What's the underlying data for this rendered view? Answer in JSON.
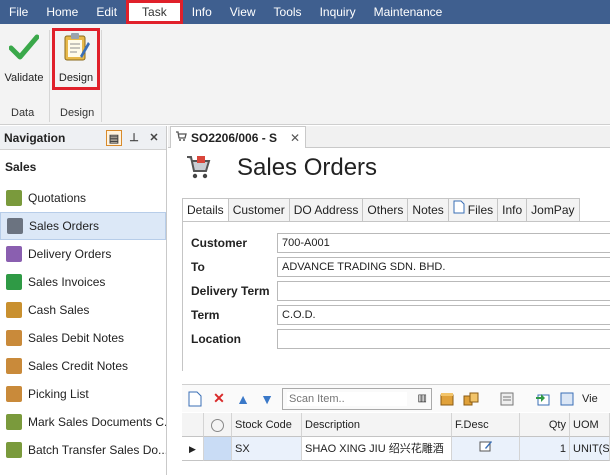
{
  "menu": [
    "File",
    "Home",
    "Edit",
    "Task",
    "Info",
    "View",
    "Tools",
    "Inquiry",
    "Maintenance"
  ],
  "menu_active": "Task",
  "ribbon": {
    "validate_label": "Validate",
    "design_label": "Design",
    "group_data": "Data",
    "group_design": "Design"
  },
  "nav": {
    "title": "Navigation",
    "section": "Sales",
    "items": [
      {
        "label": "Quotations",
        "icon": "quotation-icon",
        "color": "#7a9a3c"
      },
      {
        "label": "Sales Orders",
        "icon": "cart-icon",
        "color": "#6b7380"
      },
      {
        "label": "Delivery Orders",
        "icon": "delivery-icon",
        "color": "#8a5fb0"
      },
      {
        "label": "Sales Invoices",
        "icon": "dollar-icon",
        "color": "#2f9a45"
      },
      {
        "label": "Cash Sales",
        "icon": "cash-icon",
        "color": "#c9902f"
      },
      {
        "label": "Sales Debit Notes",
        "icon": "debit-note-icon",
        "color": "#c98a3a"
      },
      {
        "label": "Sales Credit Notes",
        "icon": "credit-note-icon",
        "color": "#c98a3a"
      },
      {
        "label": "Picking List",
        "icon": "picking-icon",
        "color": "#c98a3a"
      },
      {
        "label": "Mark Sales Documents C...",
        "icon": "mark-icon",
        "color": "#7a9a3c"
      },
      {
        "label": "Batch Transfer Sales Do...",
        "icon": "batch-icon",
        "color": "#7a9a3c"
      }
    ]
  },
  "doc_tab": "SO2206/006 - S",
  "page_title": "Sales Orders",
  "tabs": [
    "Details",
    "Customer",
    "DO Address",
    "Others",
    "Notes",
    "Files",
    "Info",
    "JomPay"
  ],
  "form": {
    "customer_label": "Customer",
    "customer_value": "700-A001",
    "to_label": "To",
    "to_value": "ADVANCE TRADING SDN. BHD.",
    "delivery_term_label": "Delivery Term",
    "delivery_term_value": "",
    "term_label": "Term",
    "term_value": "C.O.D.",
    "location_label": "Location",
    "location_value": ""
  },
  "grid_toolbar": {
    "scan_placeholder": "Scan Item..",
    "view_label": "Vie"
  },
  "grid": {
    "headers": [
      "Stock Code",
      "Description",
      "F.Desc",
      "Qty",
      "UOM"
    ],
    "rows": [
      {
        "code": "SX",
        "description": "SHAO XING JIU 绍兴花雕酒",
        "qty": "1",
        "uom": "UNIT(S)"
      }
    ]
  }
}
